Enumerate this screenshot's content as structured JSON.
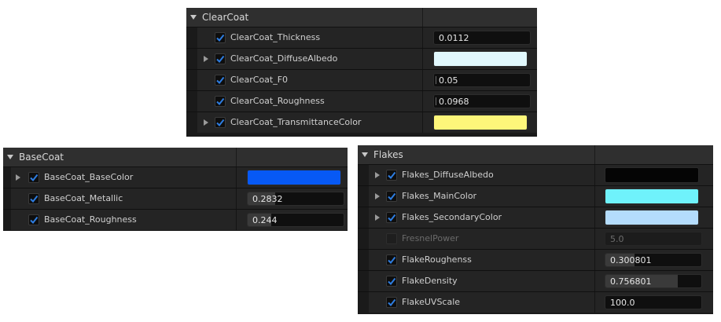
{
  "clearcoat": {
    "title": "ClearCoat",
    "rows": [
      {
        "label": "ClearCoat_Thickness",
        "value": "0.0112",
        "fill": 0.0
      },
      {
        "label": "ClearCoat_DiffuseAlbedo",
        "color": "#e1f8fd"
      },
      {
        "label": "ClearCoat_F0",
        "value": "0.05",
        "fill": 0.0
      },
      {
        "label": "ClearCoat_Roughness",
        "value": "0.0968",
        "fill": 0.0
      },
      {
        "label": "ClearCoat_TransmittanceColor",
        "color": "#fdf67a"
      }
    ]
  },
  "basecoat": {
    "title": "BaseCoat",
    "rows": [
      {
        "label": "BaseCoat_BaseColor",
        "color": "#0759f5"
      },
      {
        "label": "BaseCoat_Metallic",
        "value": "0.2832",
        "fill": 0.2832
      },
      {
        "label": "BaseCoat_Roughness",
        "value": "0.244",
        "fill": 0.244
      }
    ]
  },
  "flakes": {
    "title": "Flakes",
    "rows": [
      {
        "label": "Flakes_DiffuseAlbedo",
        "color": "#050505"
      },
      {
        "label": "Flakes_MainColor",
        "color": "#6ff2fb"
      },
      {
        "label": "Flakes_SecondaryColor",
        "color": "#b4dcfc"
      },
      {
        "label": "FresnelPower",
        "value": "5.0",
        "disabled": true
      },
      {
        "label": "FlakeRoughenss",
        "value": "0.300801",
        "fill": 0.300801
      },
      {
        "label": "FlakeDensity",
        "value": "0.756801",
        "fill": 0.756801
      },
      {
        "label": "FlakeUVScale",
        "value": "100.0",
        "fill": 0.0
      }
    ]
  },
  "colors": {
    "checkbox_accent": "#2e7de1",
    "panel_bg": "#242424",
    "header_bg": "#2f2f2f"
  }
}
